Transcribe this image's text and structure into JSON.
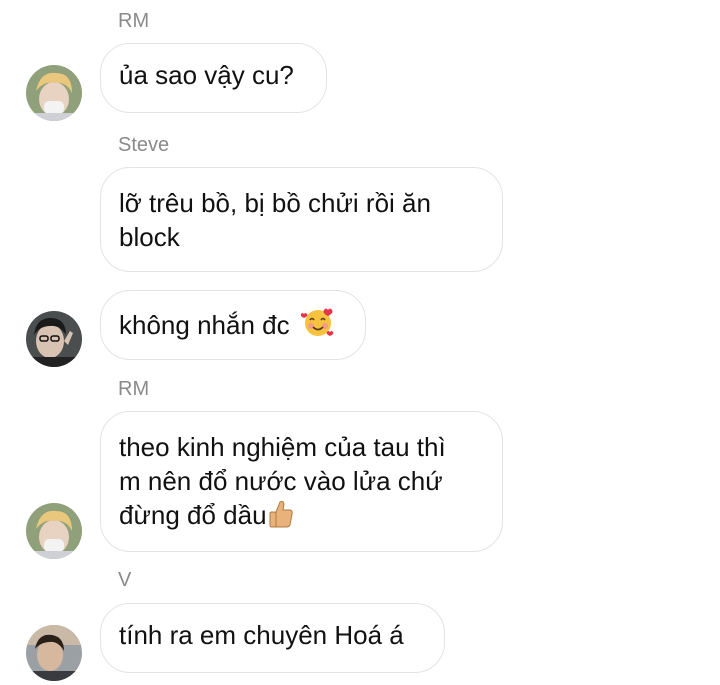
{
  "messages": [
    {
      "sender": "RM",
      "text": "ủa sao vậy cu?"
    },
    {
      "sender": "Steve",
      "text_line1": "lỡ trêu bồ, bị bồ chửi rồi ăn",
      "text_line2": "block"
    },
    {
      "sender": "",
      "text": "không nhắn đc",
      "emoji": "smiling-face-with-hearts"
    },
    {
      "sender": "RM",
      "text_line1": "theo kinh nghiệm của tau thì",
      "text_line2": "m nên đổ nước vào lửa chứ",
      "text_line3": "đừng đổ dầu",
      "emoji": "thumbs-up"
    },
    {
      "sender": "V",
      "text": "tính ra em chuyên Hoá á"
    }
  ]
}
